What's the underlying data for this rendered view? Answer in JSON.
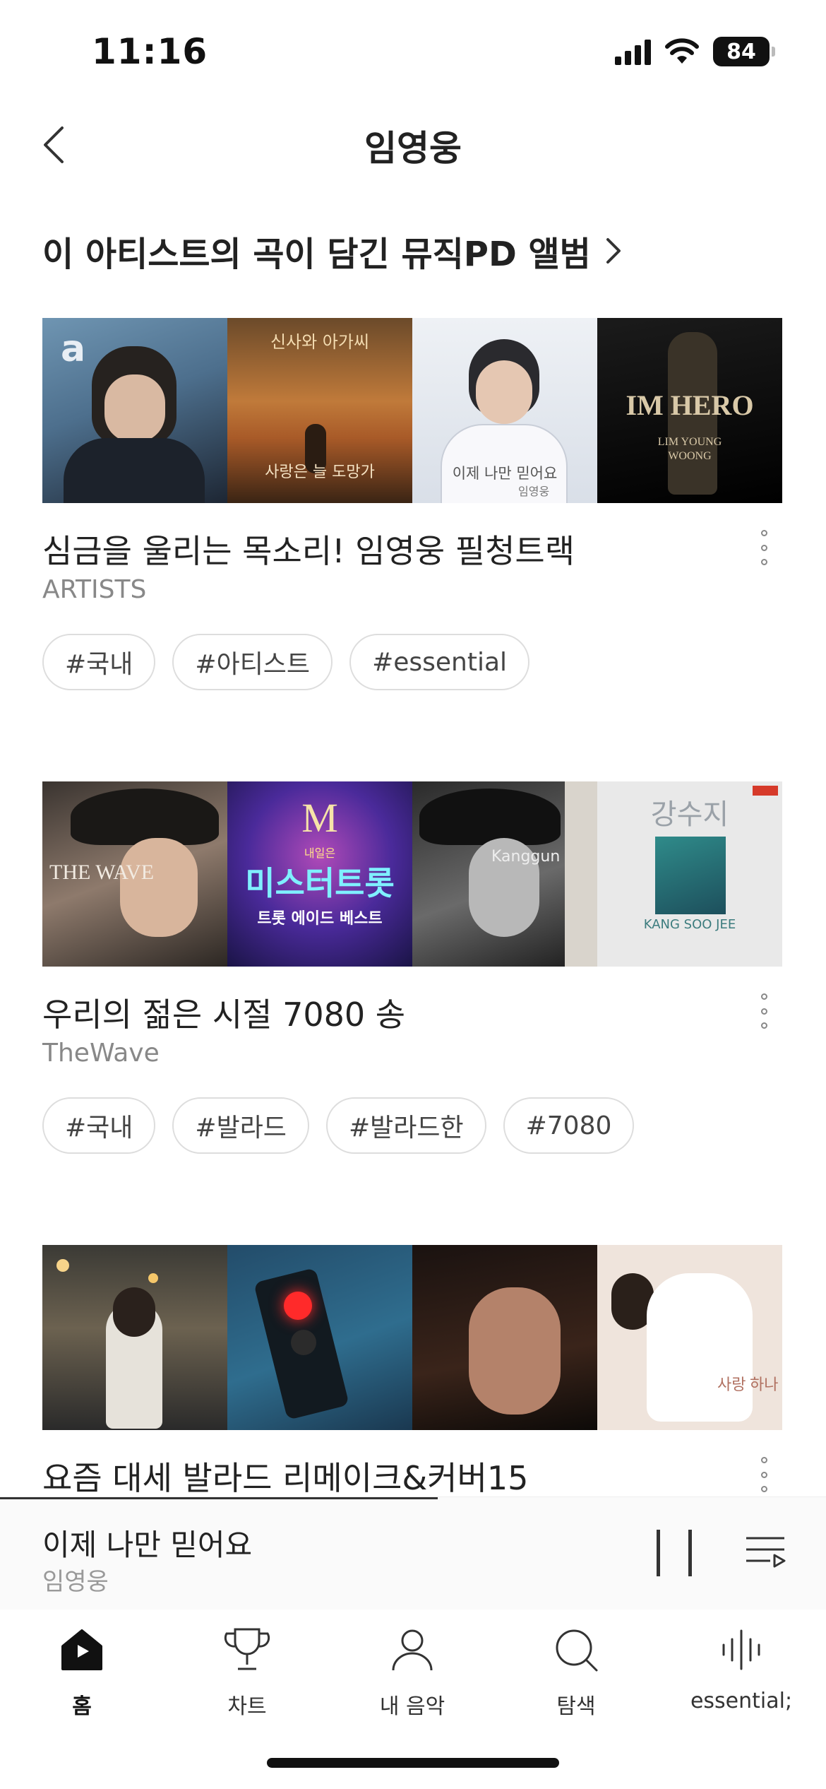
{
  "status_bar": {
    "time": "11:16",
    "battery": "84"
  },
  "header": {
    "title": "임영웅"
  },
  "section": {
    "title": "이 아티스트의 곡이 담긴 뮤직PD 앨범"
  },
  "albums": [
    {
      "title": "심금을 울리는 목소리! 임영웅 필청트랙",
      "subtitle": "ARTISTS",
      "tags": [
        "#국내",
        "#아티스트",
        "#essential"
      ],
      "cover_texts": [
        "a",
        "신사와 아가씨",
        "사랑은 늘 도망가",
        "이제 나만 믿어요",
        "임영웅",
        "IM HERO",
        "LIM YOUNG WOONG"
      ]
    },
    {
      "title": "우리의 젊은 시절 7080 송",
      "subtitle": "TheWave",
      "tags": [
        "#국내",
        "#발라드",
        "#발라드한",
        "#7080"
      ],
      "cover_texts": [
        "THE WAVE",
        "M",
        "내일은",
        "미스터트롯",
        "트롯 에이드 베스트",
        "Kanggun",
        "강수지",
        "KANG SOO JEE"
      ]
    },
    {
      "title": "요즘 대세 발라드 리메이크&커버15",
      "subtitle": "",
      "tags": [],
      "cover_texts": [
        "사랑 하나"
      ]
    }
  ],
  "now_playing": {
    "title": "이제 나만 믿어요",
    "artist": "임영웅",
    "progress": 0.53
  },
  "tabs": [
    {
      "label": "홈",
      "icon": "home-icon",
      "active": true
    },
    {
      "label": "차트",
      "icon": "trophy-icon",
      "active": false
    },
    {
      "label": "내 음악",
      "icon": "person-icon",
      "active": false
    },
    {
      "label": "탐색",
      "icon": "search-icon",
      "active": false
    },
    {
      "label": "essential;",
      "icon": "waveform-icon",
      "active": false
    }
  ]
}
